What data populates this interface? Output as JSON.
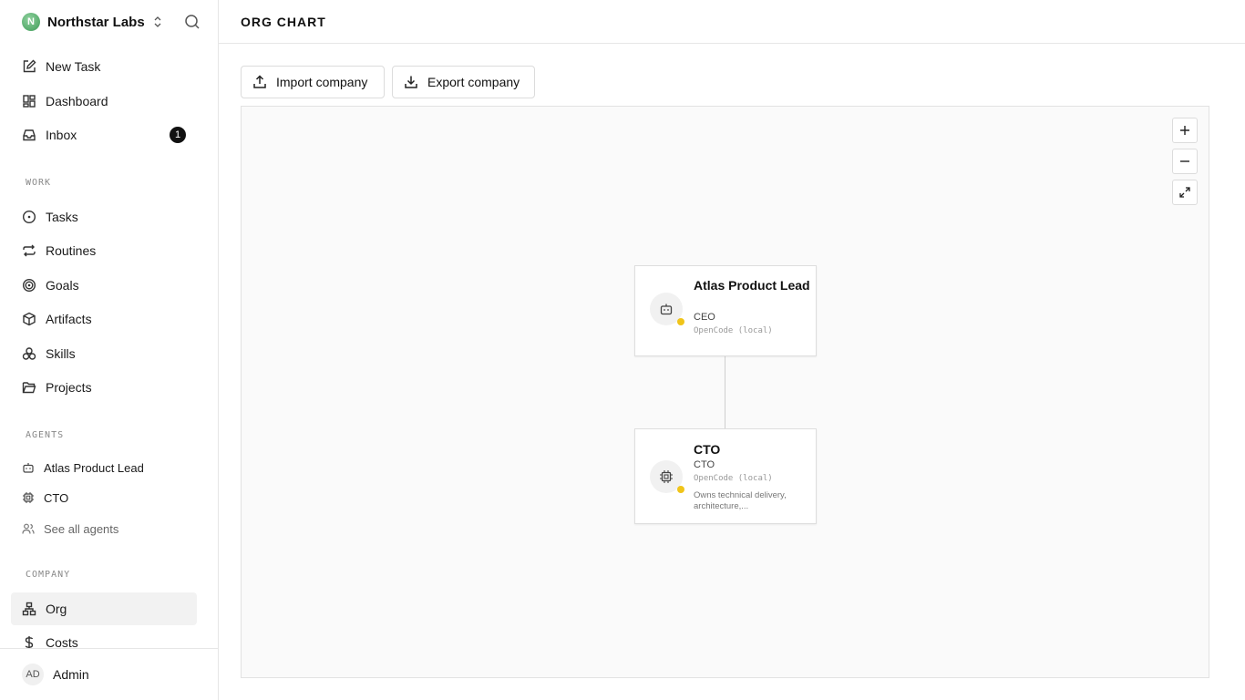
{
  "sidebar": {
    "company_name": "Northstar Labs",
    "company_initial": "N",
    "nav": [
      {
        "label": "New Task",
        "icon": "edit-icon"
      },
      {
        "label": "Dashboard",
        "icon": "dashboard-icon"
      },
      {
        "label": "Inbox",
        "icon": "inbox-icon",
        "badge": "1"
      }
    ],
    "work_label": "WORK",
    "work_items": [
      {
        "label": "Tasks",
        "icon": "circle-dot-icon"
      },
      {
        "label": "Routines",
        "icon": "repeat-icon"
      },
      {
        "label": "Goals",
        "icon": "target-icon"
      },
      {
        "label": "Artifacts",
        "icon": "box-icon"
      },
      {
        "label": "Skills",
        "icon": "skills-icon"
      },
      {
        "label": "Projects",
        "icon": "folder-icon"
      }
    ],
    "agents_label": "AGENTS",
    "agents": [
      {
        "label": "Atlas Product Lead",
        "icon": "bot-icon"
      },
      {
        "label": "CTO",
        "icon": "cpu-icon"
      },
      {
        "label": "See all agents",
        "icon": "users-icon"
      }
    ],
    "company_label": "COMPANY",
    "company_items": [
      {
        "label": "Org",
        "icon": "org-chart-icon",
        "active": true
      },
      {
        "label": "Costs",
        "icon": "dollar-icon"
      }
    ],
    "user": {
      "initials": "AD",
      "name": "Admin"
    }
  },
  "header": {
    "title": "ORG CHART"
  },
  "actions": {
    "import_label": "Import company",
    "export_label": "Export company"
  },
  "org": {
    "nodes": [
      {
        "name": "Atlas Product Lead",
        "role": "CEO",
        "adapter": "OpenCode (local)",
        "description": "",
        "status_color": "#f0c419"
      },
      {
        "name": "CTO",
        "role": "CTO",
        "adapter": "OpenCode (local)",
        "description": "Owns technical delivery, architecture,...",
        "status_color": "#f0c419"
      }
    ]
  }
}
